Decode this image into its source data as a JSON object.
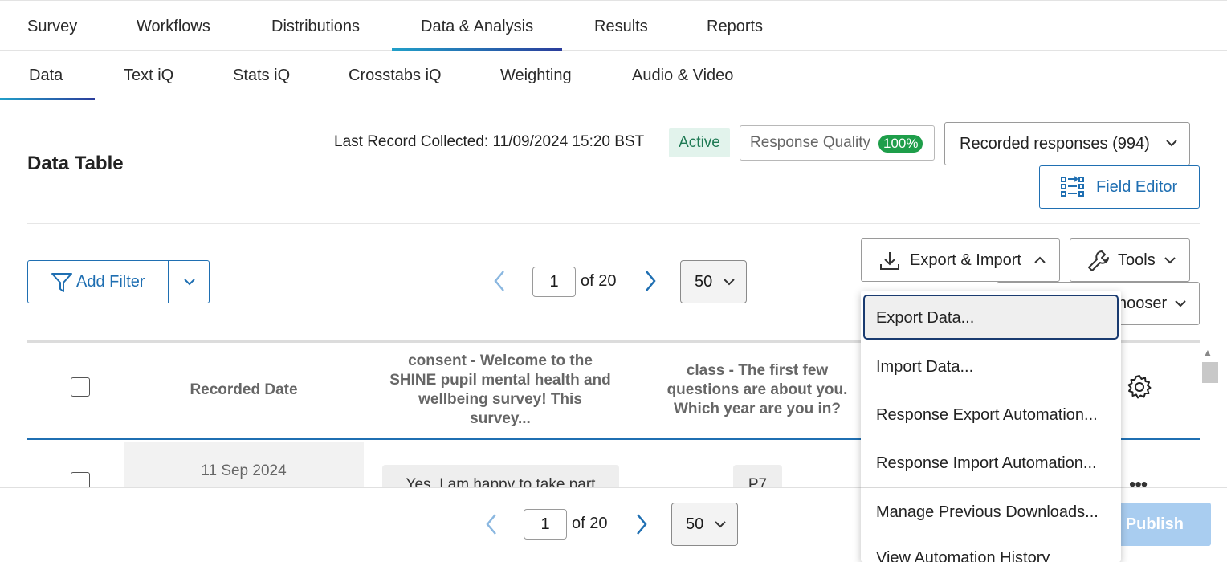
{
  "topnav": {
    "tabs": [
      {
        "label": "Survey"
      },
      {
        "label": "Workflows"
      },
      {
        "label": "Distributions"
      },
      {
        "label": "Data & Analysis"
      },
      {
        "label": "Results"
      },
      {
        "label": "Reports"
      }
    ],
    "active": "Data & Analysis"
  },
  "subnav": {
    "tabs": [
      {
        "label": "Data"
      },
      {
        "label": "Text iQ"
      },
      {
        "label": "Stats iQ"
      },
      {
        "label": "Crosstabs iQ"
      },
      {
        "label": "Weighting"
      },
      {
        "label": "Audio & Video"
      }
    ],
    "active": "Data"
  },
  "header": {
    "title": "Data Table",
    "last_record": "Last Record Collected: 11/09/2024 15:20 BST",
    "status": "Active",
    "response_quality_label": "Response Quality",
    "response_quality_value": "100%",
    "recorded_responses": "Recorded responses (994)",
    "field_editor": "Field Editor"
  },
  "toolbar": {
    "add_filter": "Add Filter",
    "page": "1",
    "of_pages": "of 20",
    "per_page": "50",
    "export_import": "Export & Import",
    "tools": "Tools",
    "chooser_partial": "hooser"
  },
  "table": {
    "columns": [
      "Recorded Date",
      "consent - Welcome to the SHINE pupil mental health and wellbeing survey! This survey...",
      "class - The first few questions are about you. Which year are you in?"
    ],
    "rows": [
      {
        "date": "11 Sep 2024",
        "consent": "Yes, I am happy to take part",
        "class": "P7"
      }
    ]
  },
  "footer": {
    "page": "1",
    "of_pages": "of 20",
    "per_page": "50",
    "publish_partial": "d Publish"
  },
  "menu": {
    "items": [
      "Export Data...",
      "Import Data...",
      "Response Export Automation...",
      "Response Import Automation...",
      "Manage Previous Downloads...",
      "View Automation History"
    ]
  },
  "colors": {
    "accent_blue": "#1f6fb2",
    "active_green": "#1e9e4a",
    "publish_disabled": "#a9cdf0"
  }
}
